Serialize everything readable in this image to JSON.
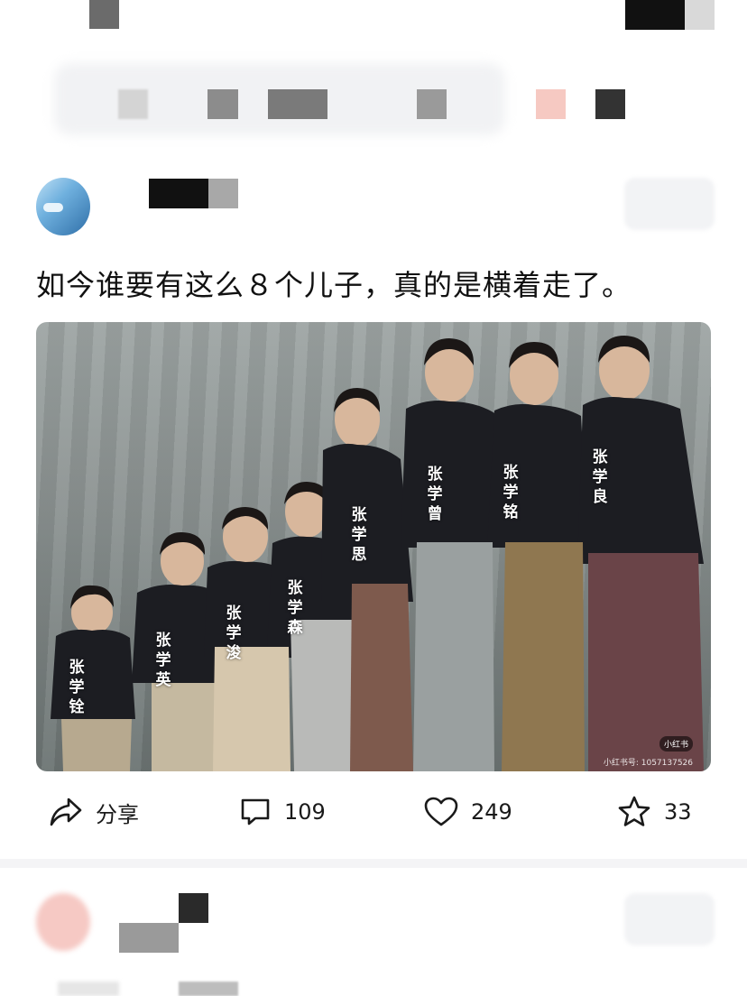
{
  "post": {
    "text": "如今谁要有这么８个儿子，真的是横着走了。",
    "photo": {
      "name_tags": [
        {
          "name": "张学铨",
          "c1": "张",
          "c2": "学",
          "c3": "铨"
        },
        {
          "name": "张学英",
          "c1": "张",
          "c2": "学",
          "c3": "英"
        },
        {
          "name": "张学浚",
          "c1": "张",
          "c2": "学",
          "c3": "浚"
        },
        {
          "name": "张学森",
          "c1": "张",
          "c2": "学",
          "c3": "森"
        },
        {
          "name": "张学思",
          "c1": "张",
          "c2": "学",
          "c3": "思"
        },
        {
          "name": "张学曾",
          "c1": "张",
          "c2": "学",
          "c3": "曾"
        },
        {
          "name": "张学铭",
          "c1": "张",
          "c2": "学",
          "c3": "铭"
        },
        {
          "name": "张学良",
          "c1": "张",
          "c2": "学",
          "c3": "良"
        }
      ],
      "watermark_badge": "小红书",
      "watermark_id": "小红书号: 1057137526"
    }
  },
  "actions": {
    "share_label": "分享",
    "comment_count": "109",
    "like_count": "249",
    "favorite_count": "33"
  },
  "icons": {
    "share": "share-arrow-icon",
    "comment": "comment-bubble-icon",
    "like": "heart-icon",
    "favorite": "star-icon"
  },
  "colors": {
    "text": "#1a1a1a",
    "background": "#ffffff",
    "divider": "#f4f4f6"
  }
}
